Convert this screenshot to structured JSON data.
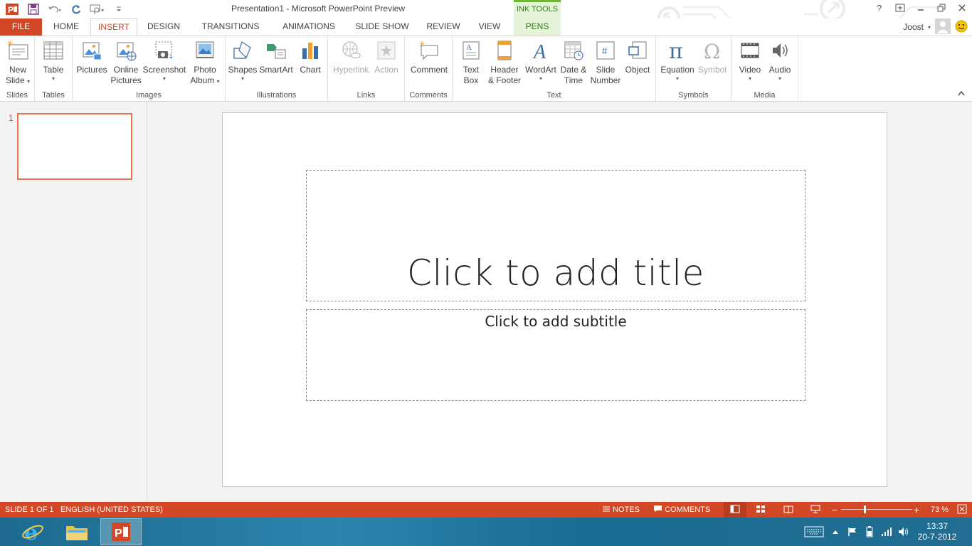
{
  "window": {
    "title": "Presentation1 - Microsoft PowerPoint Preview",
    "ink_tools_label": "INK TOOLS"
  },
  "tabs": [
    "FILE",
    "HOME",
    "INSERT",
    "DESIGN",
    "TRANSITIONS",
    "ANIMATIONS",
    "SLIDE SHOW",
    "REVIEW",
    "VIEW",
    "PENS"
  ],
  "active_tab": "INSERT",
  "user": {
    "name": "Joost"
  },
  "ribbon": {
    "groups": {
      "slides": "Slides",
      "tables": "Tables",
      "images": "Images",
      "illustrations": "Illustrations",
      "links": "Links",
      "comments": "Comments",
      "text": "Text",
      "symbols": "Symbols",
      "media": "Media"
    },
    "buttons": {
      "new_slide": [
        "New",
        "Slide"
      ],
      "table": "Table",
      "pictures": "Pictures",
      "online_pictures": [
        "Online",
        "Pictures"
      ],
      "screenshot": "Screenshot",
      "photo_album": [
        "Photo",
        "Album"
      ],
      "shapes": "Shapes",
      "smartart": "SmartArt",
      "chart": "Chart",
      "hyperlink": "Hyperlink",
      "action": "Action",
      "comment": "Comment",
      "text_box": [
        "Text",
        "Box"
      ],
      "header_footer": [
        "Header",
        "& Footer"
      ],
      "wordart": "WordArt",
      "date_time": [
        "Date &",
        "Time"
      ],
      "slide_number": [
        "Slide",
        "Number"
      ],
      "object": "Object",
      "equation": "Equation",
      "symbol": "Symbol",
      "video": "Video",
      "audio": "Audio"
    }
  },
  "thumbnails": {
    "slide_number": "1"
  },
  "slide": {
    "title_placeholder": "Click to add title",
    "subtitle_placeholder": "Click to add subtitle"
  },
  "status": {
    "slide_info": "SLIDE 1 OF 1",
    "language": "ENGLISH (UNITED STATES)",
    "notes": "NOTES",
    "comments": "COMMENTS",
    "zoom": "73 %",
    "zoom_level": 0.73
  },
  "taskbar": {
    "time": "13:37",
    "date": "20-7-2012"
  },
  "colors": {
    "accent": "#d24726",
    "ink_green": "#6fb638",
    "taskbar": "#2b84ad"
  }
}
